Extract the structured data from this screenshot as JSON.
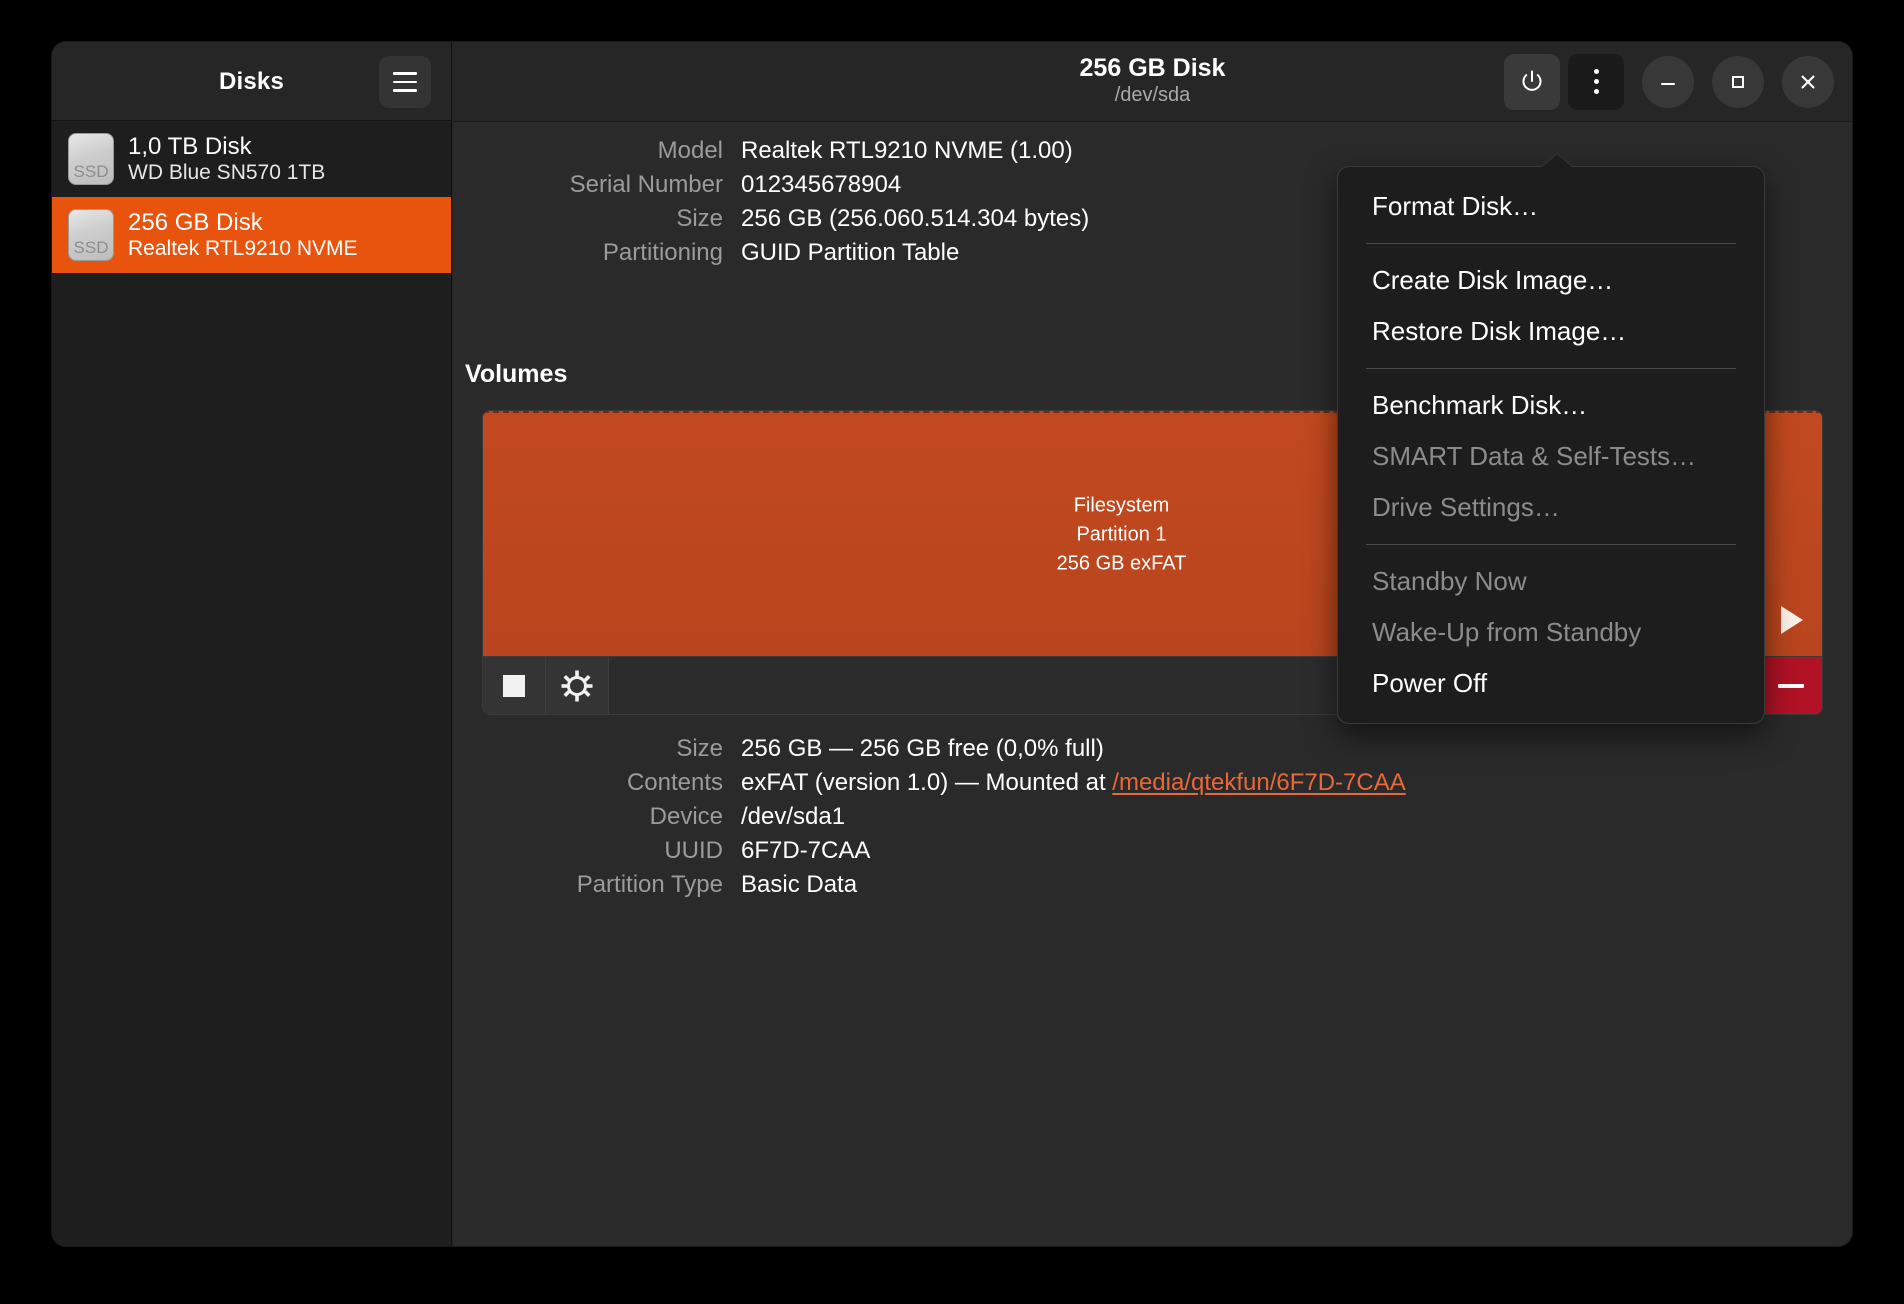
{
  "sidebar": {
    "title": "Disks",
    "menu_icon": "hamburger-icon",
    "disks": [
      {
        "name": "1,0 TB Disk",
        "model": "WD Blue SN570 1TB",
        "badge": "SSD",
        "selected": false
      },
      {
        "name": "256 GB Disk",
        "model": "Realtek RTL9210 NVME",
        "badge": "SSD",
        "selected": true
      }
    ]
  },
  "header": {
    "title": "256 GB Disk",
    "subtitle": "/dev/sda",
    "buttons": [
      {
        "name": "power-button",
        "icon": "power-icon"
      },
      {
        "name": "more-options-button",
        "icon": "vertical-dots-icon"
      },
      {
        "name": "minimize-button",
        "icon": "minimize-icon"
      },
      {
        "name": "maximize-button",
        "icon": "maximize-icon"
      },
      {
        "name": "close-button",
        "icon": "close-icon"
      }
    ]
  },
  "drive_info": [
    {
      "key": "Model",
      "value": "Realtek RTL9210 NVME (1.00)"
    },
    {
      "key": "Serial Number",
      "value": "012345678904"
    },
    {
      "key": "Size",
      "value": "256 GB (256.060.514.304 bytes)"
    },
    {
      "key": "Partitioning",
      "value": "GUID Partition Table"
    }
  ],
  "volumes": {
    "section_title": "Volumes",
    "partition": {
      "line1": "Filesystem",
      "line2": "Partition 1",
      "line3": "256 GB exFAT"
    },
    "toolbar": {
      "stop_button": "stop-icon",
      "settings_button": "gear-icon",
      "delete_button": "minus-icon",
      "mount_button": "play-icon"
    }
  },
  "volume_details": [
    {
      "key": "Size",
      "value": "256 GB — 256 GB free (0,0% full)",
      "link": ""
    },
    {
      "key": "Contents",
      "value": "exFAT (version 1.0) — Mounted at ",
      "link": "/media/qtekfun/6F7D-7CAA"
    },
    {
      "key": "Device",
      "value": "/dev/sda1",
      "link": ""
    },
    {
      "key": "UUID",
      "value": "6F7D-7CAA",
      "link": ""
    },
    {
      "key": "Partition Type",
      "value": "Basic Data",
      "link": ""
    }
  ],
  "popup_menu": {
    "items": [
      {
        "label": "Format Disk…",
        "disabled": false,
        "separator_after": true
      },
      {
        "label": "Create Disk Image…",
        "disabled": false,
        "separator_after": false
      },
      {
        "label": "Restore Disk Image…",
        "disabled": false,
        "separator_after": true
      },
      {
        "label": "Benchmark Disk…",
        "disabled": false,
        "separator_after": false
      },
      {
        "label": "SMART Data & Self-Tests…",
        "disabled": true,
        "separator_after": false
      },
      {
        "label": "Drive Settings…",
        "disabled": true,
        "separator_after": true
      },
      {
        "label": "Standby Now",
        "disabled": true,
        "separator_after": false
      },
      {
        "label": "Wake-Up from Standby",
        "disabled": true,
        "separator_after": false
      },
      {
        "label": "Power Off",
        "disabled": false,
        "separator_after": false
      }
    ]
  },
  "colors": {
    "accent_orange": "#e8540e",
    "partition_orange": "#c2491f",
    "delete_red": "#b11226",
    "link_orange": "#e8683a",
    "window_bg": "#2a2a2a",
    "sidebar_bg": "#1e1e1e",
    "popup_bg": "#1d1d1d"
  }
}
